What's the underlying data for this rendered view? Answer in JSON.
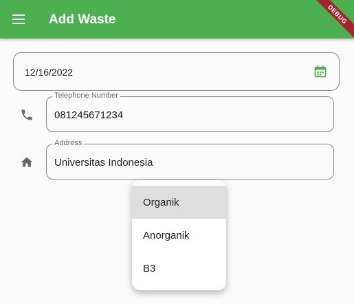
{
  "appbar": {
    "title": "Add Waste",
    "debug_banner": "DEBUG",
    "color": "#4caf50"
  },
  "date_field": {
    "value": "12/16/2022",
    "icon": "calendar-icon"
  },
  "phone_field": {
    "label": "Telephone Number",
    "value": "081245671234",
    "icon": "phone-icon"
  },
  "address_field": {
    "label": "Address",
    "value": "Universitas Indonesia",
    "icon": "home-icon"
  },
  "dropdown": {
    "options": [
      "Organik",
      "Anorganik",
      "B3"
    ],
    "highlighted": "Organik"
  }
}
